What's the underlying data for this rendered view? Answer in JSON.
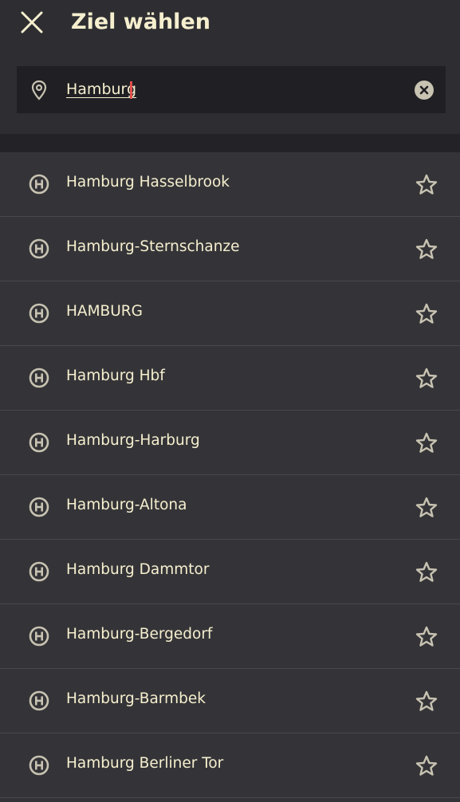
{
  "header": {
    "title": "Ziel wählen",
    "close_icon": "close-icon"
  },
  "search": {
    "value": "Hamburg",
    "pin_icon": "location-pin-icon",
    "clear_icon": "clear-circle-icon"
  },
  "colors": {
    "text": "#f6efcf",
    "background": "#343438",
    "header_background": "#2e2e32",
    "input_background": "#202024",
    "icon_gray": "#c8c3b2",
    "caret": "#e0504e"
  },
  "results": [
    {
      "label": "Hamburg Hasselbrook",
      "icon": "station-h-icon",
      "favorite_icon": "star-outline-icon"
    },
    {
      "label": "Hamburg-Sternschanze",
      "icon": "station-h-icon",
      "favorite_icon": "star-outline-icon"
    },
    {
      "label": "HAMBURG",
      "icon": "station-h-icon",
      "favorite_icon": "star-outline-icon"
    },
    {
      "label": "Hamburg Hbf",
      "icon": "station-h-icon",
      "favorite_icon": "star-outline-icon"
    },
    {
      "label": "Hamburg-Harburg",
      "icon": "station-h-icon",
      "favorite_icon": "star-outline-icon"
    },
    {
      "label": "Hamburg-Altona",
      "icon": "station-h-icon",
      "favorite_icon": "star-outline-icon"
    },
    {
      "label": "Hamburg Dammtor",
      "icon": "station-h-icon",
      "favorite_icon": "star-outline-icon"
    },
    {
      "label": "Hamburg-Bergedorf",
      "icon": "station-h-icon",
      "favorite_icon": "star-outline-icon"
    },
    {
      "label": "Hamburg-Barmbek",
      "icon": "station-h-icon",
      "favorite_icon": "star-outline-icon"
    },
    {
      "label": "Hamburg Berliner Tor",
      "icon": "station-h-icon",
      "favorite_icon": "star-outline-icon"
    }
  ]
}
